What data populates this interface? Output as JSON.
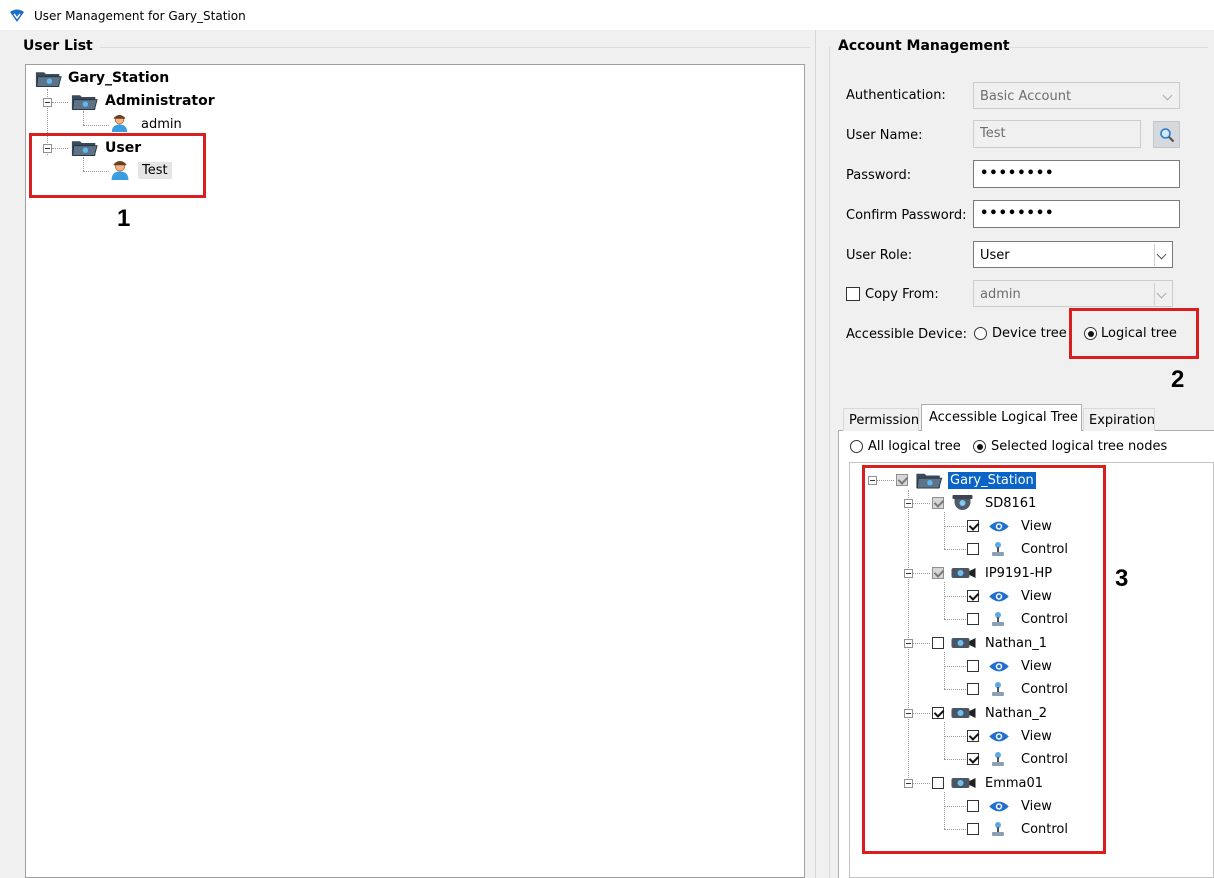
{
  "window": {
    "title": "User Management for Gary_Station"
  },
  "user_list": {
    "group_title": "User List",
    "root": "Gary_Station",
    "groups": [
      {
        "name": "Administrator",
        "users": [
          "admin"
        ]
      },
      {
        "name": "User",
        "users": [
          "Test"
        ]
      }
    ]
  },
  "account": {
    "group_title": "Account Management",
    "authentication_label": "Authentication:",
    "authentication_value": "Basic Account",
    "username_label": "User Name:",
    "username_value": "Test",
    "password_label": "Password:",
    "password_value": "••••••••",
    "confirm_label": "Confirm Password:",
    "confirm_value": "••••••••",
    "role_label": "User Role:",
    "role_value": "User",
    "copy_from_label": "Copy From:",
    "copy_from_value": "admin",
    "accessible_label": "Accessible Device:",
    "device_tree": "Device tree",
    "logical_tree": "Logical tree"
  },
  "tabs": {
    "permission": "Permission",
    "accessible_logical_tree": "Accessible Logical Tree",
    "expiration": "Expiration"
  },
  "scope": {
    "all": "All logical tree",
    "selected": "Selected logical tree nodes"
  },
  "logical_tree": {
    "root": "Gary_Station",
    "devices": [
      {
        "name": "SD8161",
        "view": "View",
        "control": "Control"
      },
      {
        "name": "IP9191-HP",
        "view": "View",
        "control": "Control"
      },
      {
        "name": "Nathan_1",
        "view": "View",
        "control": "Control"
      },
      {
        "name": "Nathan_2",
        "view": "View",
        "control": "Control"
      },
      {
        "name": "Emma01",
        "view": "View",
        "control": "Control"
      }
    ]
  },
  "annotations": {
    "one": "1",
    "two": "2",
    "three": "3"
  },
  "colors": {
    "highlight": "#d81e1e",
    "selection": "#0a64c8"
  }
}
